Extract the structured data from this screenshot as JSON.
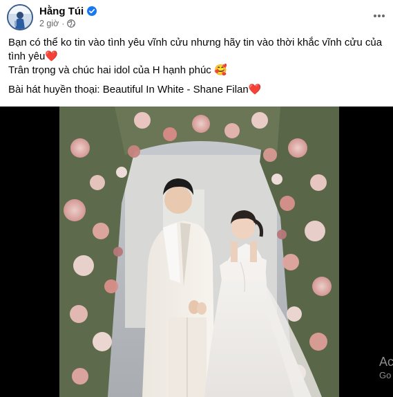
{
  "post": {
    "author": "Hằng Túi",
    "time": "2 giờ",
    "dot": "·"
  },
  "content": {
    "line1": "Bạn có thể ko tin vào tình yêu vĩnh cửu nhưng hãy tin vào thời khắc vĩnh cửu của tình yêu",
    "line1_emoji": "❤️",
    "line2": "Trân trọng và chúc hai idol của H hạnh phúc",
    "line2_emoji": "🥰",
    "line3": "Bài hát huyền thoại: Beautiful In White - Shane Filan",
    "line3_emoji": "❤️"
  },
  "watermark": {
    "line1": "Ac",
    "line2": "Go"
  },
  "icons": {
    "verified": "verified-badge-icon",
    "privacy": "globe-icon",
    "more": "more-horizontal-icon",
    "reaction_heart": "red-heart-emoji",
    "reaction_love": "smiling-face-with-hearts-emoji"
  },
  "colors": {
    "verified_blue": "#1877f2",
    "secondary_text": "#65676b",
    "heart_red": "#e41e3f",
    "media_background": "#000000"
  }
}
